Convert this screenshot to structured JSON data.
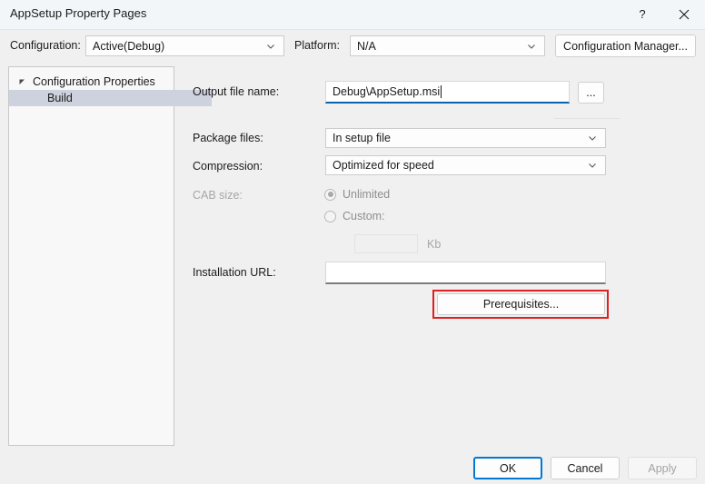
{
  "window": {
    "title": "AppSetup Property Pages",
    "help_label": "?",
    "close_label": "×"
  },
  "toolbar": {
    "configuration_label": "Configuration:",
    "configuration_value": "Active(Debug)",
    "platform_label": "Platform:",
    "platform_value": "N/A",
    "configuration_manager_label": "Configuration Manager..."
  },
  "tree": {
    "root_label": "Configuration Properties",
    "child_label": "Build"
  },
  "fields": {
    "output_file_name_label": "Output file name:",
    "output_file_name_value": "Debug\\AppSetup.msi",
    "browse_label": "...",
    "package_files_label": "Package files:",
    "package_files_value": "In setup file",
    "compression_label": "Compression:",
    "compression_value": "Optimized for speed",
    "cab_size_label": "CAB size:",
    "cab_unlimited_label": "Unlimited",
    "cab_custom_label": "Custom:",
    "cab_custom_value": "",
    "cab_unit_label": "Kb",
    "installation_url_label": "Installation URL:",
    "installation_url_value": "",
    "prerequisites_label": "Prerequisites..."
  },
  "footer": {
    "ok_label": "OK",
    "cancel_label": "Cancel",
    "apply_label": "Apply"
  },
  "colors": {
    "accent": "#0078d4",
    "focus_underline": "#0a64ad",
    "highlight": "#cdd2de",
    "annotation": "#e02020"
  }
}
